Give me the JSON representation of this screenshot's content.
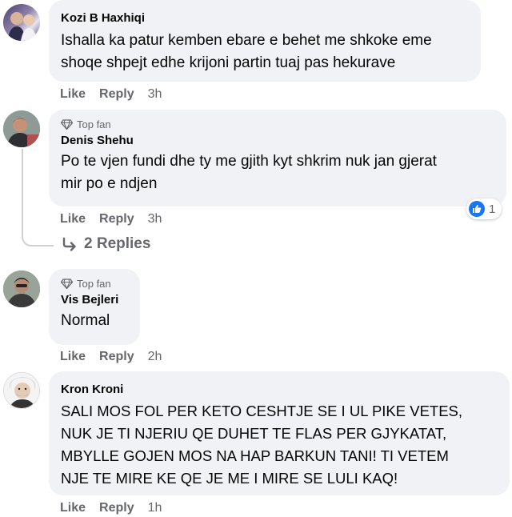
{
  "comments": [
    {
      "author": "Kozi B Haxhiqi",
      "badge": "",
      "text": [
        "Ishalla ka patur kemben ebare e behet me shkoke eme",
        "shoqe shpejt edhe krijoni partin tuaj pas hekurave"
      ],
      "like_label": "Like",
      "reply_label": "Reply",
      "time": "3h"
    },
    {
      "author": "Denis Shehu",
      "badge": "Top fan",
      "text": [
        "Po te vjen fundi dhe ty me gjith kyt shkrim nuk jan gjerat",
        "mir po e ndjen"
      ],
      "like_label": "Like",
      "reply_label": "Reply",
      "time": "3h",
      "reaction_count": "1",
      "replies_label": "2 Replies"
    },
    {
      "author": "Vis Bejleri",
      "badge": "Top fan",
      "text": [
        "Normal"
      ],
      "like_label": "Like",
      "reply_label": "Reply",
      "time": "2h"
    },
    {
      "author": "Kron Kroni",
      "badge": "",
      "text": [
        "SALI MOS FOL PER KETO CESHTJE SE I UL PIKE VETES,",
        "NUK JE TI NJERIU QE DUHET TE FLAS PER GJYKATAT,",
        "MBYLLE GOJEN MOS NA HAP BARKUN TANI! TI VETEM",
        "NJE TE MIRE KE QE JE ME I MIRE SE LULI KAQ!"
      ],
      "like_label": "Like",
      "reply_label": "Reply",
      "time": "1h"
    }
  ],
  "colors": {
    "bubble": "#f0f2f5",
    "meta": "#65676b",
    "like_blue": "#1877f2"
  },
  "icons": [
    "diamond-icon",
    "like-icon",
    "reply-arrow-icon"
  ]
}
